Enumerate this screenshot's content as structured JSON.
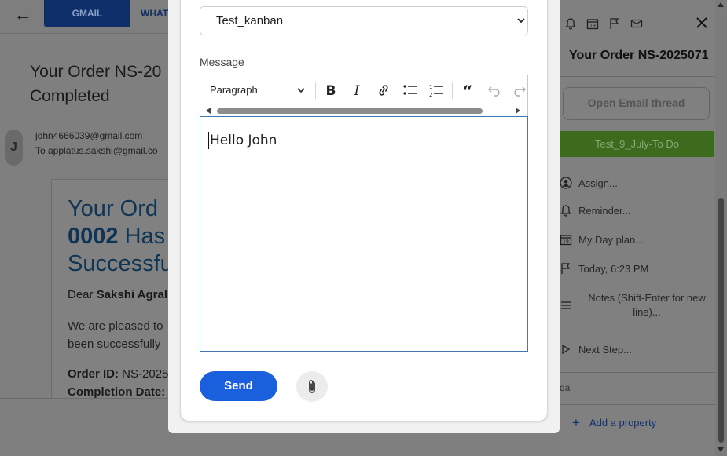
{
  "app": {
    "tabs": [
      {
        "label": "GMAIL",
        "active": true
      },
      {
        "label": "WHAT",
        "active": false
      }
    ]
  },
  "email": {
    "subject": "Your Order NS-20… Completed",
    "subject_line1": "Your Order NS-20",
    "subject_line2": "Completed",
    "avatar_initial": "J",
    "from": "john4666039@gmail.com",
    "to": "To applatus.sakshi@gmail.co",
    "body": {
      "heading_line1": "Your Ord",
      "heading_line2_bold": "0002",
      "heading_line2_rest": " Has",
      "heading_line3": "Successfu",
      "dear_prefix": "Dear ",
      "dear_name": "Sakshi Agral",
      "para_line1": "We are pleased to",
      "para_line2": "been successfully",
      "order_id_label": "Order ID:",
      "order_id_value": " NS-2025",
      "completion_label": "Completion Date:"
    }
  },
  "modal": {
    "board_select": {
      "value": "Test_kanban"
    },
    "message_label": "Message",
    "toolbar": {
      "block_format": "Paragraph",
      "buttons": [
        "bold-icon",
        "italic-icon",
        "link-icon",
        "bulleted-list-icon",
        "numbered-list-icon",
        "blockquote-icon",
        "undo-icon",
        "redo-icon"
      ]
    },
    "editor_text": "Hello John",
    "send_label": "Send",
    "attach_icon": "paperclip-icon"
  },
  "side_panel": {
    "icons": [
      "bell-icon",
      "calendar-icon",
      "flag-icon",
      "envelope-icon"
    ],
    "title": "Your Order NS-2025071",
    "open_thread_label": "Open Email thread",
    "stage_label": "Test_9_July-To Do",
    "stage_color": "#3d6b1e",
    "rows": {
      "assign": "Assign...",
      "reminder": "Reminder...",
      "my_day": "My Day plan...",
      "date": "Today, 6:23 PM",
      "notes": "Notes (Shift-Enter for new line)...",
      "next_step": "Next Step..."
    },
    "qa_text": "qa",
    "add_property_label": "Add a property"
  },
  "colors": {
    "primary_blue": "#1a5fdc",
    "editor_focus_border": "#3f78b5",
    "overlay": "#808080"
  }
}
